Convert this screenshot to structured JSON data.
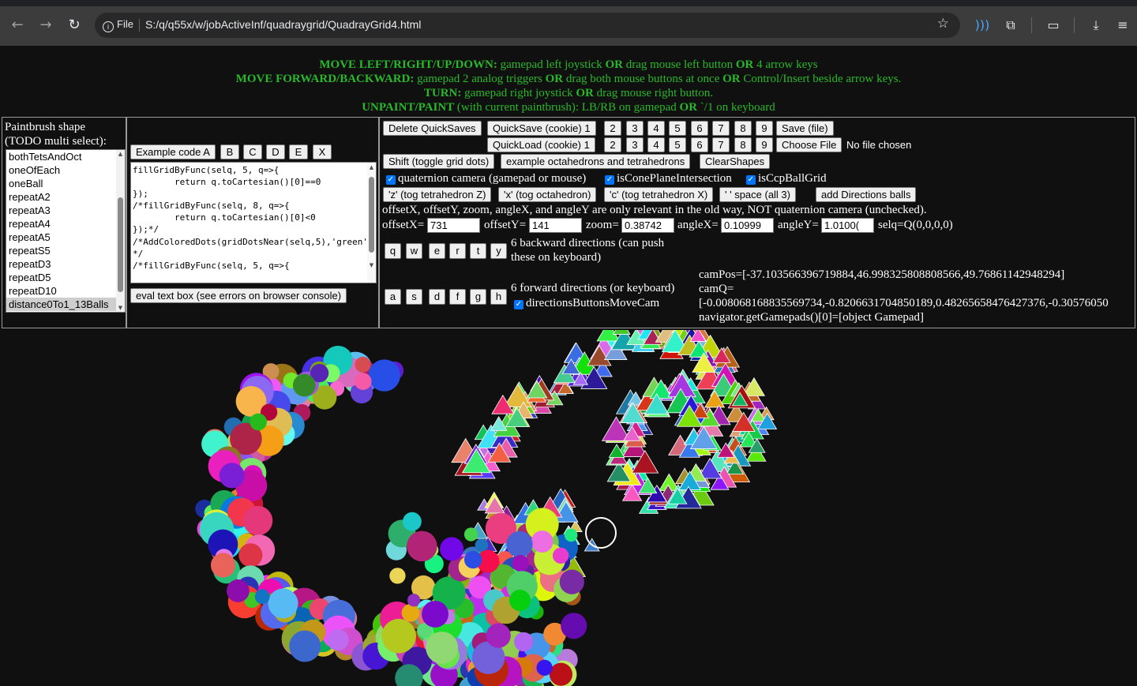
{
  "browser": {
    "info_label": "File",
    "url": "S:/q/q55x/w/jobActiveInf/quadraygrid/QuadrayGrid4.html",
    "icons": [
      "back-icon",
      "forward-icon",
      "reload-icon",
      "info-icon",
      "star-icon",
      "read-aloud-icon",
      "extensions-icon",
      "split-screen-icon",
      "downloads-icon",
      "menu-icon"
    ]
  },
  "instructions": [
    {
      "bold": "MOVE LEFT/RIGHT/UP/DOWN:",
      "parts": [
        " gamepad left joystick ",
        "OR",
        " drag mouse left button ",
        "OR",
        " 4 arrow keys"
      ]
    },
    {
      "bold": "MOVE FORWARD/BACKWARD:",
      "parts": [
        " gamepad 2 analog triggers ",
        "OR",
        " drag both mouse buttons at once ",
        "OR",
        " Control/Insert beside arrow keys."
      ]
    },
    {
      "bold": "TURN:",
      "parts": [
        " gamepad right joystick ",
        "OR",
        " drag mouse right button."
      ]
    },
    {
      "bold": "UNPAINT/PAINT",
      "parts": [
        " (with current paintbrush): LB/RB on gamepad ",
        "OR",
        " `/1 on keyboard"
      ]
    }
  ],
  "paintbrush": {
    "label_line1": "Paintbrush shape",
    "label_line2": "(TODO multi select):",
    "options": [
      "bothTetsAndOct",
      "oneOfEach",
      "oneBall",
      "repeatA2",
      "repeatA3",
      "repeatA4",
      "repeatA5",
      "repeatS5",
      "repeatD3",
      "repeatD5",
      "repeatD10",
      "distance0To1_13Balls"
    ],
    "selected": "distance0To1_13Balls"
  },
  "code_panel": {
    "example_buttons": [
      "Example code A",
      "B",
      "C",
      "D",
      "E",
      "X"
    ],
    "code": "fillGridByFunc(selq, 5, q=>{\n\treturn q.toCartesian()[0]==0\n});\n/*fillGridByFunc(selq, 8, q=>{\n\treturn q.toCartesian()[0]<0\n});*/\n/*AddColoredDots(gridDotsNear(selq,5),'green');\n*/\n/*fillGridByFunc(selq, 5, q=>{",
    "eval_button": "eval text box (see errors on browser console)"
  },
  "controls": {
    "delete_quicksaves": "Delete QuickSaves",
    "quicksave": "QuickSave (cookie) 1",
    "quickload": "QuickLoad (cookie) 1",
    "slots": [
      "2",
      "3",
      "4",
      "5",
      "6",
      "7",
      "8",
      "9"
    ],
    "save_file": "Save (file)",
    "choose_file": "Choose File",
    "no_file": "No file chosen",
    "shift_button": "Shift (toggle grid dots)",
    "example_octa_button": "example octahedrons and tetrahedrons",
    "clear_shapes_button": "ClearShapes",
    "checkboxes": [
      "quaternion camera (gamepad or mouse)",
      "isConePlaneIntersection",
      "isCcpBallGrid"
    ],
    "tog_buttons": [
      "'z' (tog tetrahedron Z)",
      "'x' (tog octahedron)",
      "'c' (tog tetrahedron X)",
      "' ' space (all 3)"
    ],
    "add_directions_button": "add Directions balls",
    "note": "offsetX, offsetY, zoom, angleX, and angleY are only relevant in the old way, NOT quaternion camera (unchecked).",
    "offsetX_label": "offsetX=",
    "offsetX": "731",
    "offsetY_label": "offsetY=",
    "offsetY": "141",
    "zoom_label": "zoom=",
    "zoom": "0.38742",
    "angleX_label": "angleX=",
    "angleX": "0.10999",
    "angleY_label": "angleY=",
    "angleY": "1.0100(",
    "selq": "selq=Q(0,0,0,0)",
    "backward_keys": [
      "q",
      "w",
      "e",
      "r",
      "t",
      "y"
    ],
    "backward_label_1": "6 backward directions (can push",
    "backward_label_2": "these on keyboard)",
    "forward_keys": [
      "a",
      "s",
      "d",
      "f",
      "g",
      "h"
    ],
    "forward_label": "6 forward directions (or keyboard)",
    "directions_checkbox": "directionsButtonsMoveCam",
    "campos": "camPos=[-37.103566396719884,46.998325808808566,49.76861142948294]",
    "camq_label": "camQ=",
    "camq": "[-0.008068168835569734,-0.8206631704850189,0.48265658476427376,-0.30576050",
    "gamepads": "navigator.getGamepads()[0]=[object Gamepad]"
  },
  "colors": {
    "instructions_green": "#29b829",
    "background": "#101010"
  }
}
